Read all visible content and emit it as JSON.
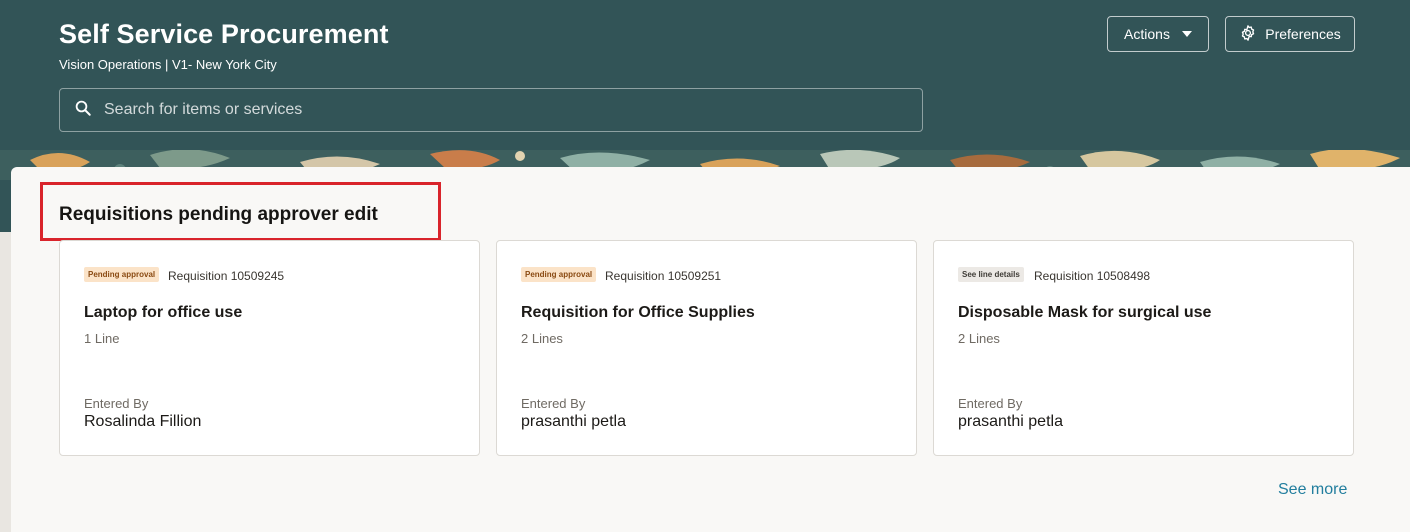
{
  "header": {
    "title": "Self Service Procurement",
    "subtitle": "Vision Operations | V1- New York City",
    "actions_label": "Actions",
    "preferences_label": "Preferences",
    "search": {
      "placeholder": "Search for items or services"
    },
    "bg_color": "#325457"
  },
  "icons": {
    "search": "search-icon",
    "actions_caret": "chevron-down-icon",
    "preferences": "gear-icon"
  },
  "section": {
    "title": "Requisitions pending approver edit",
    "highlight_color": "#d9242b",
    "see_more_label": "See more"
  },
  "cards": [
    {
      "badge": "Pending approval",
      "requisition": "Requisition 10509245",
      "title": "Laptop for office use",
      "lines": "1 Line",
      "entered_by_label": "Entered By",
      "entered_by": "Rosalinda Fillion"
    },
    {
      "badge": "Pending approval",
      "requisition": "Requisition 10509251",
      "title": "Requisition for Office Supplies",
      "lines": "2 Lines",
      "entered_by_label": "Entered By",
      "entered_by": "prasanthi petla"
    },
    {
      "badge": "See line details",
      "requisition": "Requisition 10508498",
      "title": "Disposable Mask for surgical use",
      "lines": "2 Lines",
      "entered_by_label": "Entered By",
      "entered_by": "prasanthi petla"
    }
  ]
}
